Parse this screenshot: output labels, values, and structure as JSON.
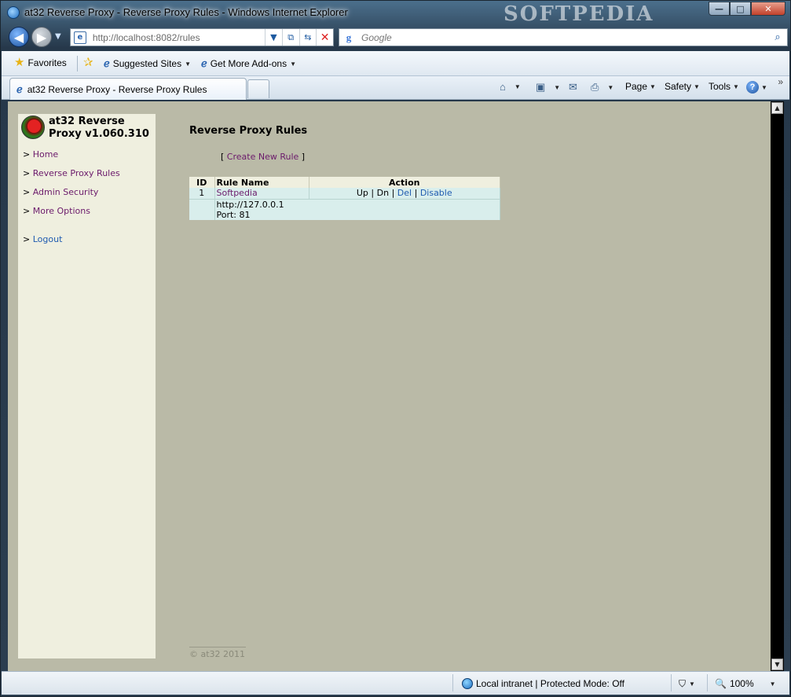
{
  "window": {
    "title": "at32 Reverse Proxy - Reverse Proxy Rules - Windows Internet Explorer",
    "watermark": "SOFTPEDIA",
    "controls": {
      "minimize": "—",
      "maximize": "□",
      "close": "✕"
    }
  },
  "address_bar": {
    "url": "http://localhost:8082/rules",
    "search_placeholder": "Google"
  },
  "favorites_bar": {
    "favorites_label": "Favorites",
    "suggested_sites_label": "Suggested Sites",
    "addons_label": "Get More Add-ons"
  },
  "tabs": [
    {
      "label": "at32 Reverse Proxy - Reverse Proxy Rules"
    }
  ],
  "command_bar": {
    "page_label": "Page",
    "safety_label": "Safety",
    "tools_label": "Tools"
  },
  "sidebar": {
    "app_title": "at32 Reverse Proxy v1.060.310",
    "bullet": ">",
    "items": [
      {
        "label": "Home"
      },
      {
        "label": "Reverse Proxy Rules"
      },
      {
        "label": "Admin Security"
      },
      {
        "label": "More Options"
      }
    ],
    "logout_label": "Logout"
  },
  "main": {
    "title": "Reverse Proxy Rules",
    "create_link": "Create New Rule",
    "bracket_open": "[",
    "bracket_close": "]"
  },
  "rules_table": {
    "headers": {
      "id": "ID",
      "name": "Rule Name",
      "action": "Action"
    },
    "rows": [
      {
        "id": "1",
        "name": "Softpedia",
        "actions": {
          "up": "Up",
          "dn": "Dn",
          "del": "Del",
          "disable": "Disable"
        },
        "separator": "|",
        "target": "http://127.0.0.1",
        "port": "Port: 81"
      }
    ]
  },
  "footer": {
    "copyright": "© at32 2011"
  },
  "status_bar": {
    "zone": "Local intranet | Protected Mode: Off",
    "zoom": "100%"
  }
}
